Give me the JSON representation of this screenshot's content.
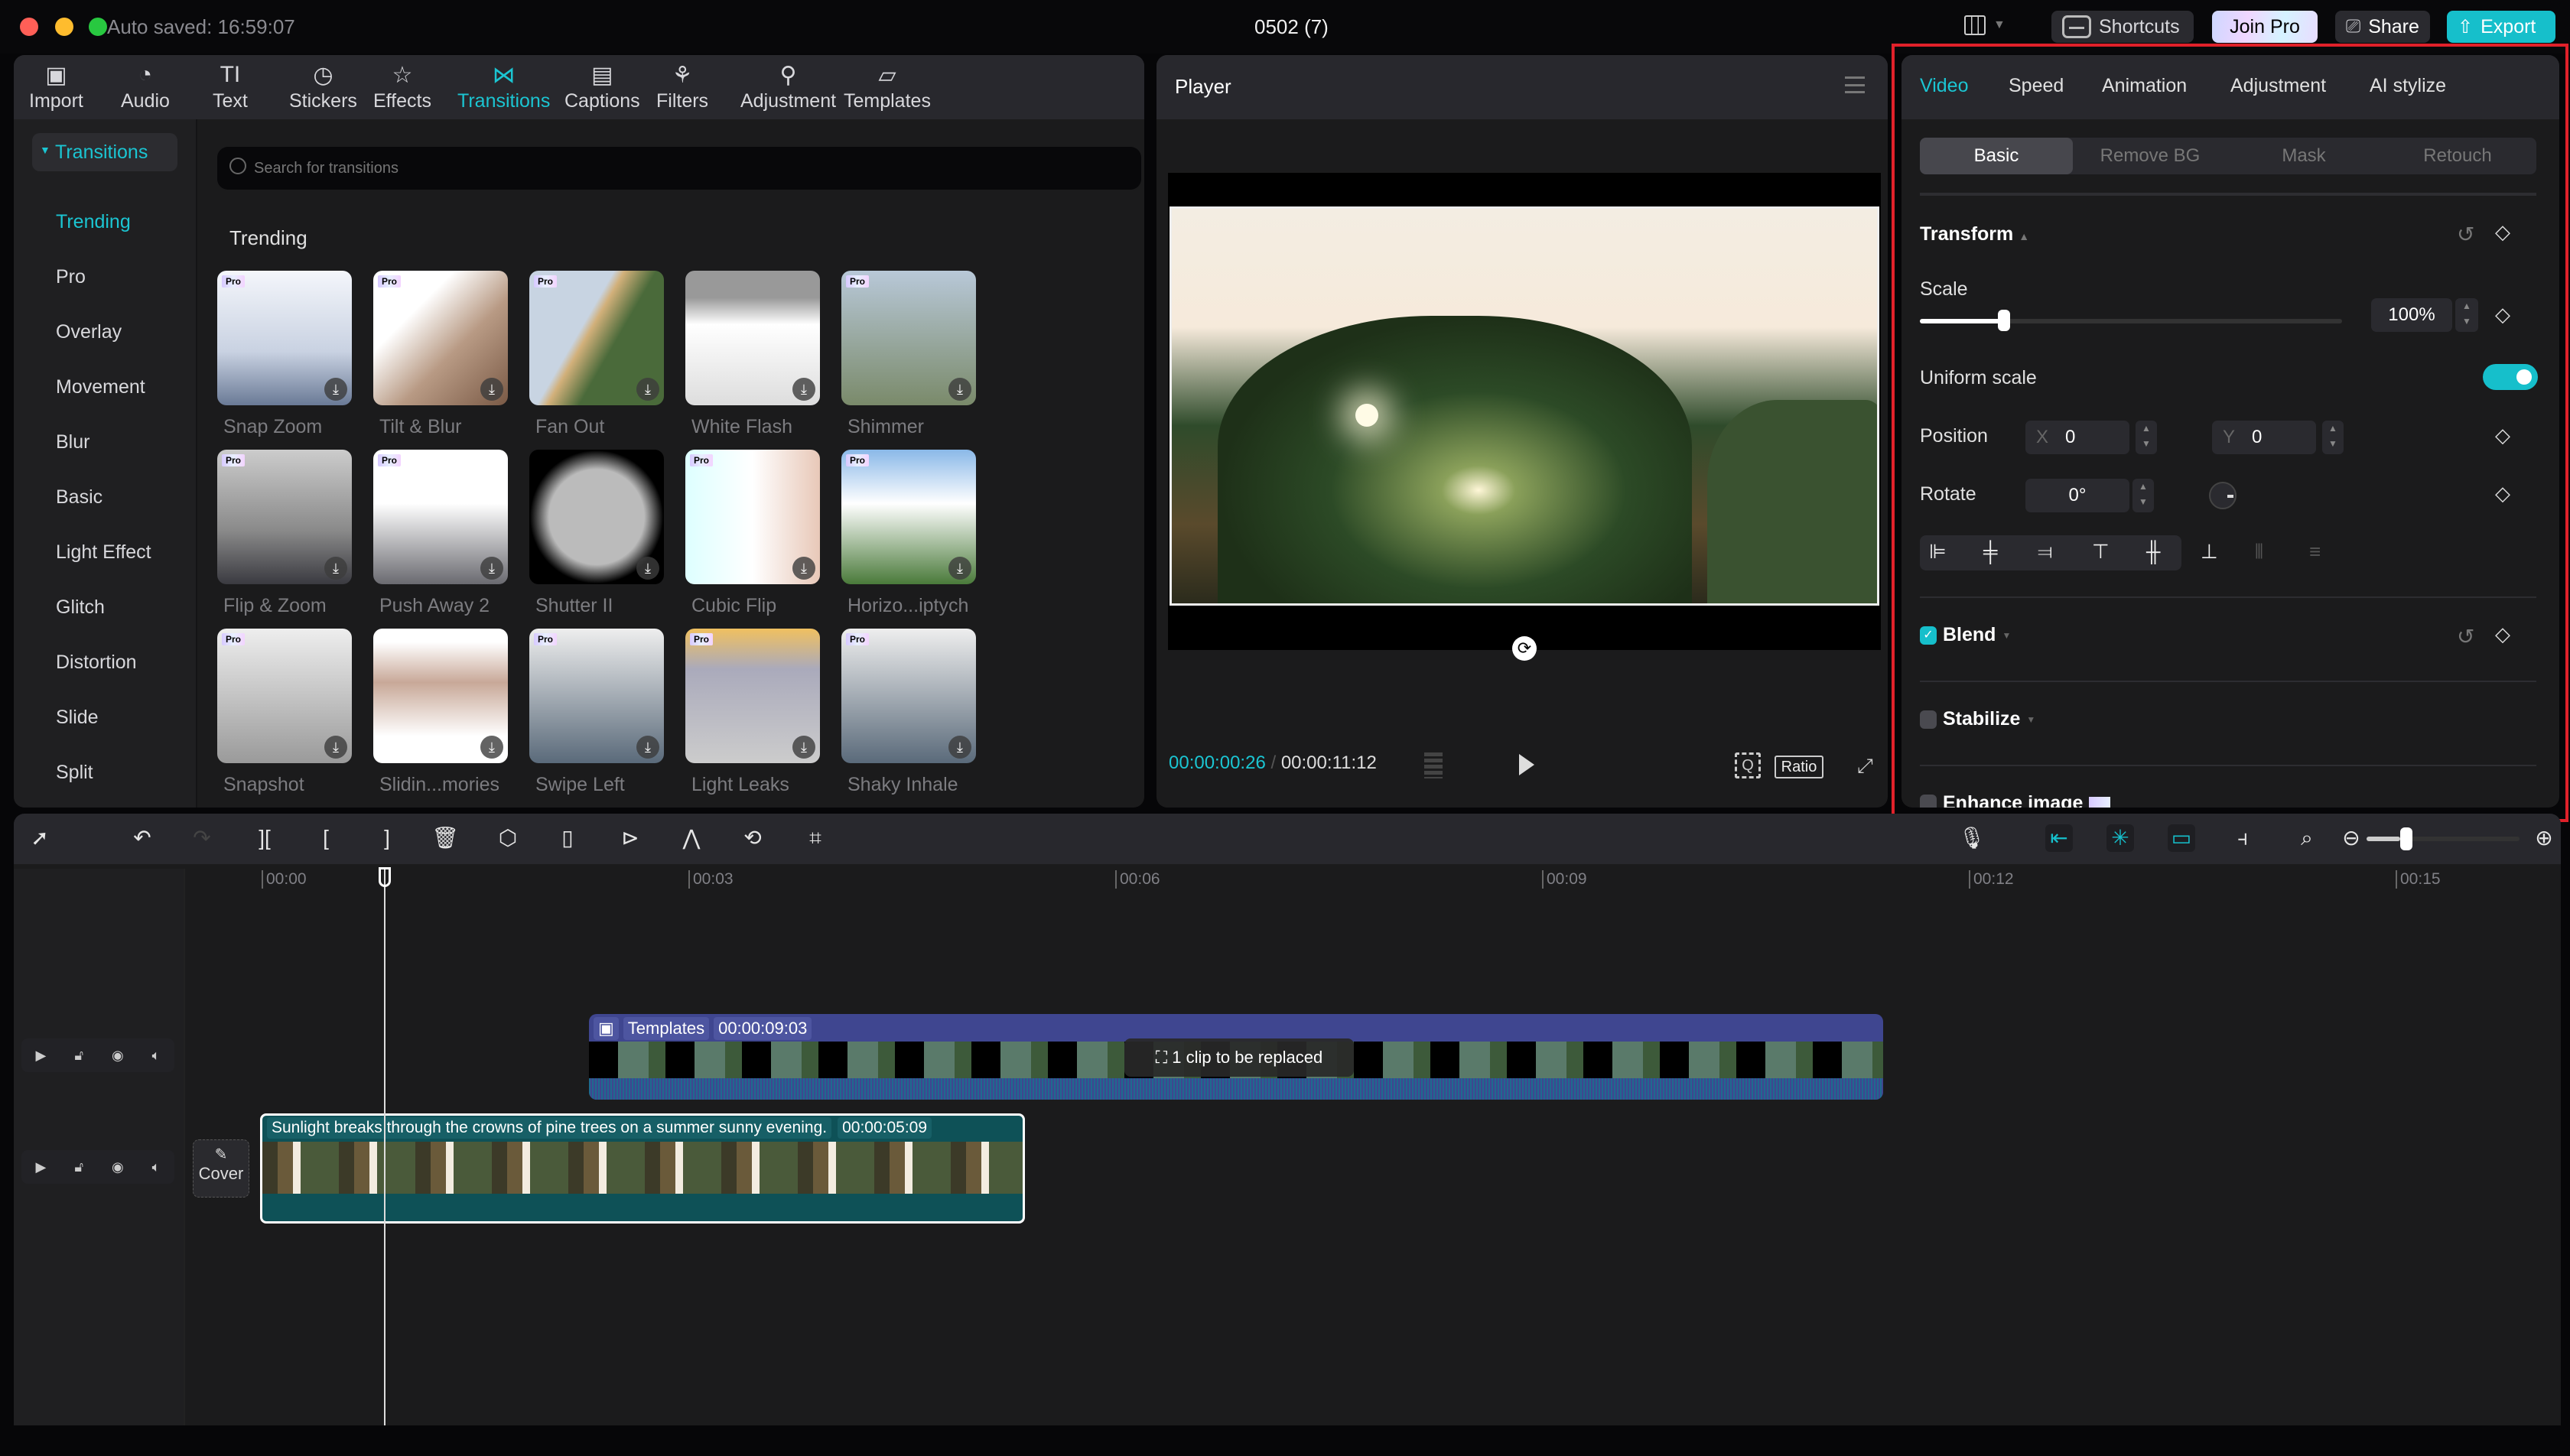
{
  "titlebar": {
    "autosave": "Auto saved: 16:59:07",
    "title": "0502 (7)",
    "shortcuts": "Shortcuts",
    "join_pro": "Join Pro",
    "share": "Share",
    "export": "Export"
  },
  "toolbar": {
    "items": [
      {
        "label": "Import",
        "icon": "import-icon"
      },
      {
        "label": "Audio",
        "icon": "audio-icon"
      },
      {
        "label": "Text",
        "icon": "text-icon"
      },
      {
        "label": "Stickers",
        "icon": "stickers-icon"
      },
      {
        "label": "Effects",
        "icon": "effects-icon"
      },
      {
        "label": "Transitions",
        "icon": "transitions-icon",
        "active": true
      },
      {
        "label": "Captions",
        "icon": "captions-icon"
      },
      {
        "label": "Filters",
        "icon": "filters-icon"
      },
      {
        "label": "Adjustment",
        "icon": "adjustment-icon"
      },
      {
        "label": "Templates",
        "icon": "templates-icon"
      }
    ]
  },
  "categories": {
    "header": "Transitions",
    "items": [
      "Trending",
      "Pro",
      "Overlay",
      "Movement",
      "Blur",
      "Basic",
      "Light Effect",
      "Glitch",
      "Distortion",
      "Slide",
      "Split"
    ],
    "active": "Trending"
  },
  "search": {
    "placeholder": "Search for transitions"
  },
  "section_title": "Trending",
  "transitions": [
    {
      "name": "Snap Zoom",
      "pro": true
    },
    {
      "name": "Tilt & Blur",
      "pro": true
    },
    {
      "name": "Fan Out",
      "pro": true
    },
    {
      "name": "White Flash",
      "pro": false
    },
    {
      "name": "Shimmer",
      "pro": true
    },
    {
      "name": "Flip & Zoom",
      "pro": true
    },
    {
      "name": "Push Away 2",
      "pro": true
    },
    {
      "name": "Shutter II",
      "pro": false
    },
    {
      "name": "Cubic Flip",
      "pro": true
    },
    {
      "name": "Horizo...iptych",
      "pro": true
    },
    {
      "name": "Snapshot",
      "pro": true
    },
    {
      "name": "Slidin...mories",
      "pro": false
    },
    {
      "name": "Swipe Left",
      "pro": true
    },
    {
      "name": "Light Leaks",
      "pro": true
    },
    {
      "name": "Shaky Inhale",
      "pro": true
    }
  ],
  "pro_badge": "Pro",
  "player": {
    "title": "Player",
    "current_time": "00:00:00:26",
    "total_time": "00:00:11:12",
    "ratio": "Ratio"
  },
  "properties": {
    "tabs": [
      "Video",
      "Speed",
      "Animation",
      "Adjustment",
      "AI stylize"
    ],
    "active_tab": "Video",
    "subtabs": [
      "Basic",
      "Remove BG",
      "Mask",
      "Retouch"
    ],
    "active_subtab": "Basic",
    "transform": "Transform",
    "scale_label": "Scale",
    "scale_value": "100%",
    "scale_fraction": 0.2,
    "uniform_scale": "Uniform scale",
    "uniform_scale_on": true,
    "position_label": "Position",
    "x_label": "X",
    "x_value": "0",
    "y_label": "Y",
    "y_value": "0",
    "rotate_label": "Rotate",
    "rotate_value": "0°",
    "blend": "Blend",
    "blend_checked": true,
    "stabilize": "Stabilize",
    "stabilize_checked": false,
    "enhance": "Enhance image"
  },
  "timeline": {
    "ticks": [
      "00:00",
      "00:03",
      "00:06",
      "00:09",
      "00:12",
      "00:15"
    ],
    "template_clip": {
      "label": "Templates",
      "duration": "00:00:09:03",
      "overlay": "1 clip to be replaced"
    },
    "main_clip": {
      "label": "Sunlight breaks through the crowns of pine trees on a summer sunny evening.",
      "duration": "00:00:05:09"
    },
    "cover": "Cover",
    "zoom_fraction": 0.22
  },
  "colors": {
    "accent": "#1bc5d2",
    "template_clip": "#3f4690",
    "main_clip": "#0e5157",
    "highlight_box": "#e0212a"
  }
}
